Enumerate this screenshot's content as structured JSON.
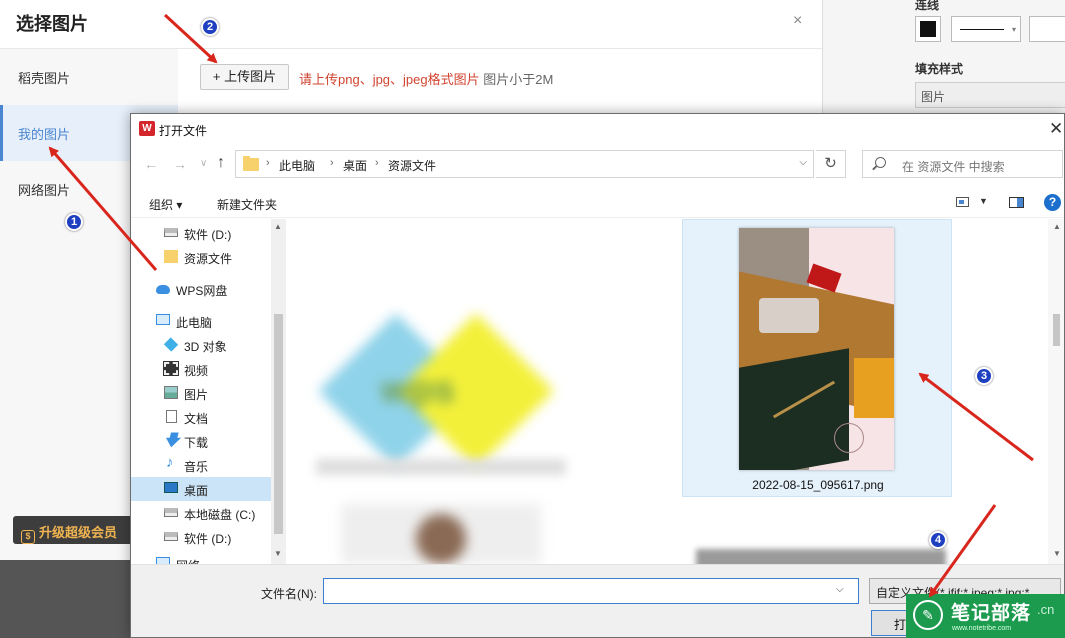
{
  "right_panel": {
    "line_label": "连线",
    "fill_label": "填充样式",
    "fill_value": "图片"
  },
  "select_dialog": {
    "title": "选择图片",
    "close": "×",
    "sidebar": [
      {
        "label": "稻壳图片"
      },
      {
        "label": "我的图片"
      },
      {
        "label": "网络图片"
      }
    ],
    "upgrade": "升级超级会员",
    "upload_button": "+ 上传图片",
    "upload_hint": "请上传png、jpg、jpeg格式图片",
    "upload_limit": "图片小于2M"
  },
  "file_dialog": {
    "logo": "W",
    "title": "打开文件",
    "close": "✕",
    "nav": {
      "back": "←",
      "forward": "→",
      "history": "∨",
      "up": "↑",
      "refresh": "↻"
    },
    "breadcrumb": [
      "此电脑",
      "桌面",
      "资源文件"
    ],
    "search_placeholder": "在 资源文件 中搜索",
    "toolbar": {
      "organize": "组织 ▾",
      "new_folder": "新建文件夹",
      "help": "?"
    },
    "tree": [
      {
        "label": "软件 (D:)",
        "icon": "drive-icon"
      },
      {
        "label": "资源文件",
        "icon": "folder-icon"
      },
      {
        "label": "WPS网盘",
        "icon": "cloud-icon"
      },
      {
        "label": "此电脑",
        "icon": "computer-icon"
      },
      {
        "label": "3D 对象",
        "icon": "cube-icon"
      },
      {
        "label": "视频",
        "icon": "video-icon"
      },
      {
        "label": "图片",
        "icon": "picture-icon"
      },
      {
        "label": "文档",
        "icon": "document-icon"
      },
      {
        "label": "下载",
        "icon": "download-icon"
      },
      {
        "label": "音乐",
        "icon": "music-icon"
      },
      {
        "label": "桌面",
        "icon": "desktop-icon"
      },
      {
        "label": "本地磁盘 (C:)",
        "icon": "drive-icon"
      },
      {
        "label": "软件 (D:)",
        "icon": "drive-icon"
      },
      {
        "label": "网络",
        "icon": "network-icon"
      }
    ],
    "selected_file": "2022-08-15_095617.png",
    "filename_label": "文件名(N):",
    "filename_value": "",
    "filetype": "自定义文件(*.jfif;*.jpeg;*.jpg;*",
    "open_button": "打开(O)"
  },
  "watermark": {
    "brand": "笔记部落",
    "suffix": ".cn",
    "url": "www.notetribe.com"
  },
  "annotations": {
    "badges": [
      "1",
      "2",
      "3",
      "4"
    ],
    "arrow_color": "#d9261c"
  },
  "colors": {
    "accent": "#4a86d0",
    "hint": "#d1442f",
    "selection": "#cce4f7"
  }
}
